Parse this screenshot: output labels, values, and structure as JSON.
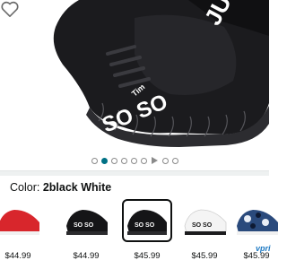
{
  "product": {
    "shoe_text_tongue": "JUS",
    "shoe_text_side": "SO SO",
    "shoe_text_small": "Tim",
    "favorite_icon": "heart-outline-icon"
  },
  "carousel": {
    "active_index": 1,
    "dot_count": 8,
    "video_indicator_icon": "play-icon"
  },
  "variation": {
    "label": "Color:",
    "selected_value": "2black White",
    "swatches": [
      {
        "color_name": "red",
        "price": "$44.99"
      },
      {
        "color_name": "black",
        "price": "$44.99"
      },
      {
        "color_name": "2black White",
        "price": "$45.99",
        "selected": true
      },
      {
        "color_name": "white",
        "price": "$45.99"
      },
      {
        "color_name": "blue camo",
        "price": "$45.99"
      }
    ],
    "prime_badge": "vpri"
  },
  "colors": {
    "accent": "#007185",
    "text": "#0f1111",
    "prime": "#1f7ac3"
  }
}
